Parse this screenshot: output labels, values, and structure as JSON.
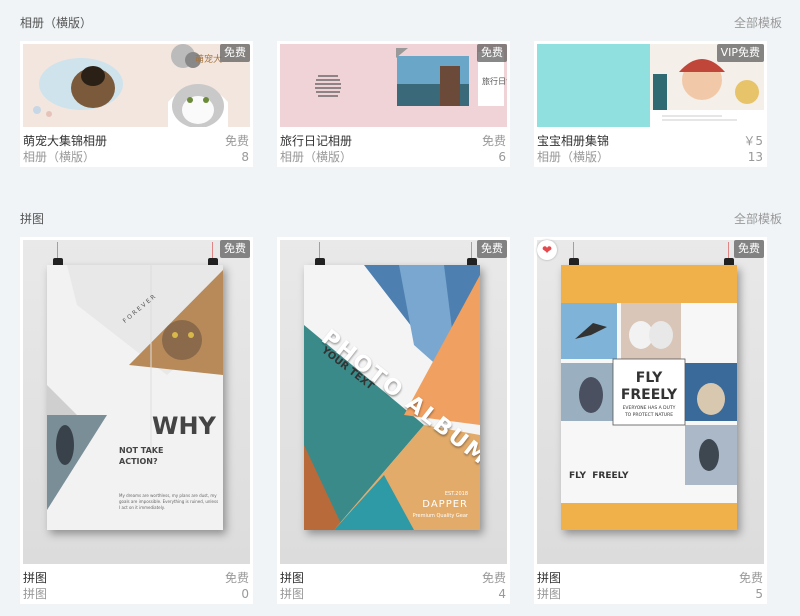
{
  "sections": [
    {
      "title": "相册（横版）",
      "more": "全部模板",
      "cards": [
        {
          "name": "萌宠大集锦相册",
          "price": "免费",
          "category": "相册（横版）",
          "count": "8",
          "badge": "免费",
          "thumb_text": "萌宠大"
        },
        {
          "name": "旅行日记相册",
          "price": "免费",
          "category": "相册（横版）",
          "count": "6",
          "badge": "免费",
          "thumb_text": "旅行日记"
        },
        {
          "name": "宝宝相册集锦",
          "price": "￥5",
          "category": "相册（横版）",
          "count": "13",
          "badge": "VIP免费"
        }
      ]
    },
    {
      "title": "拼图",
      "more": "全部模板",
      "cards": [
        {
          "name": "拼图",
          "price": "免费",
          "category": "拼图",
          "count": "0",
          "badge": "免费",
          "poster": {
            "tag": "FOREVER",
            "headline": "WHY",
            "sub": "NOT TAKE ACTION?",
            "body": "My dreams are worthless, my plans are dust, my goals are impossible. Everything is ruined, unless I act on it immediately."
          }
        },
        {
          "name": "拼图",
          "price": "免费",
          "category": "拼图",
          "count": "4",
          "badge": "免费",
          "poster": {
            "headline": "PHOTO ALBUM",
            "sub": "YOUR TEXT",
            "brand": "DAPPER",
            "year": "EST.2018",
            "tagline": "Premium Quality Gear"
          }
        },
        {
          "name": "拼图",
          "price": "免费",
          "category": "拼图",
          "count": "5",
          "badge": "免费",
          "favorited": true,
          "poster": {
            "headline1": "FLY",
            "headline2": "FREELY",
            "line1": "EVERYONE HAS A DUTY",
            "line2": "TO PROTECT NATURE",
            "footer": "FLY  FREELY"
          }
        }
      ]
    }
  ],
  "colors": {
    "page_bg": "#f0f4f7",
    "badge_bg": "#5a5a5a",
    "fav": "#e5484d",
    "poster_orange": "#f0b04a",
    "teal": "#8fe0de"
  }
}
